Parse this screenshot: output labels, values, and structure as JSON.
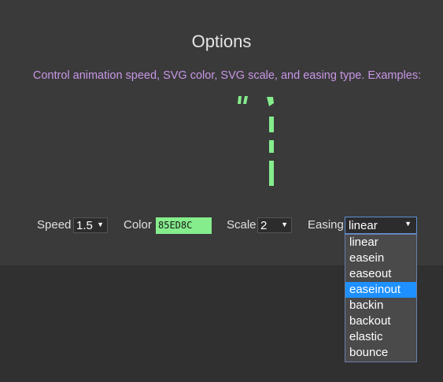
{
  "header": {
    "title": "Options",
    "description": "Control animation speed, SVG color, SVG scale, and easing type. Examples:"
  },
  "controls": {
    "speed": {
      "label": "Speed",
      "value": "1.5"
    },
    "color": {
      "label": "Color",
      "value": "85ED8C"
    },
    "scale": {
      "label": "Scale",
      "value": "2"
    },
    "easing": {
      "label": "Easing",
      "value": "linear",
      "options": [
        "linear",
        "easein",
        "easeout",
        "easeinout",
        "backin",
        "backout",
        "elastic",
        "bounce"
      ],
      "highlighted": "easeinout"
    }
  },
  "colors": {
    "accent": "#85ED8C",
    "description_text": "#c896e6",
    "dropdown_highlight": "#1e90ff"
  },
  "icons": {
    "example_glyph": "dashed-digit-one"
  }
}
